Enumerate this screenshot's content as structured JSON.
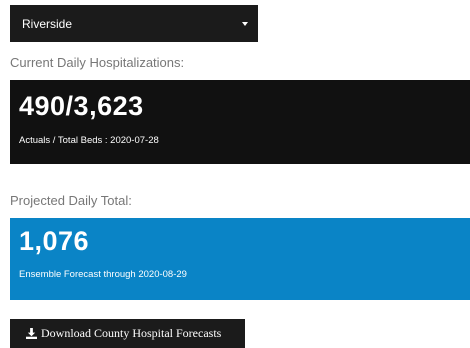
{
  "county_select": {
    "value": "Riverside"
  },
  "hospitalizations": {
    "label": "Current Daily Hospitalizations:",
    "value": "490/3,623",
    "caption": "Actuals / Total Beds : 2020-07-28"
  },
  "projection": {
    "label": "Projected Daily Total:",
    "value": "1,076",
    "caption": "Ensemble Forecast through 2020-08-29"
  },
  "download": {
    "label": "Download County Hospital Forecasts",
    "icon": "download-icon"
  },
  "colors": {
    "dark": "#111111",
    "accent_blue": "#0a84c6",
    "label_gray": "#777777"
  }
}
